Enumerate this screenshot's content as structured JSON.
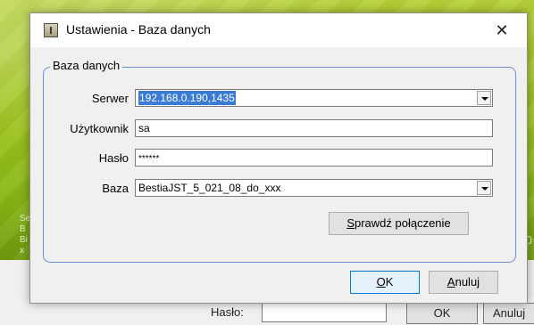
{
  "background": {
    "left_text": "Se\nB\nBi\nx",
    "right_text": ".0",
    "haslo_label": "Hasło:",
    "ok_label": "OK",
    "cancel_label": "Anuluj"
  },
  "dialog": {
    "title": "Ustawienia - Baza danych",
    "group_title": "Baza danych",
    "fields": {
      "server": {
        "label": "Serwer",
        "value": "192.168.0.190,1435"
      },
      "user": {
        "label": "Użytkownik",
        "value": "sa"
      },
      "password": {
        "label": "Hasło",
        "value": "******"
      },
      "database": {
        "label": "Baza",
        "value": "BestiaJST_5_021_08_do_xxx"
      }
    },
    "buttons": {
      "test_connection_first": "S",
      "test_connection_rest": "prawdź połączenie",
      "ok_first": "O",
      "ok_rest": "K",
      "cancel_first": "A",
      "cancel_rest": "nuluj"
    }
  },
  "icons": {
    "close": "close-icon",
    "app": "app-icon",
    "dropdown": "chevron-down-icon"
  },
  "colors": {
    "background_green": "#9cc21f",
    "group_border": "#6b8fd6",
    "selection": "#3a7bd5",
    "default_button_border": "#0078d7"
  }
}
